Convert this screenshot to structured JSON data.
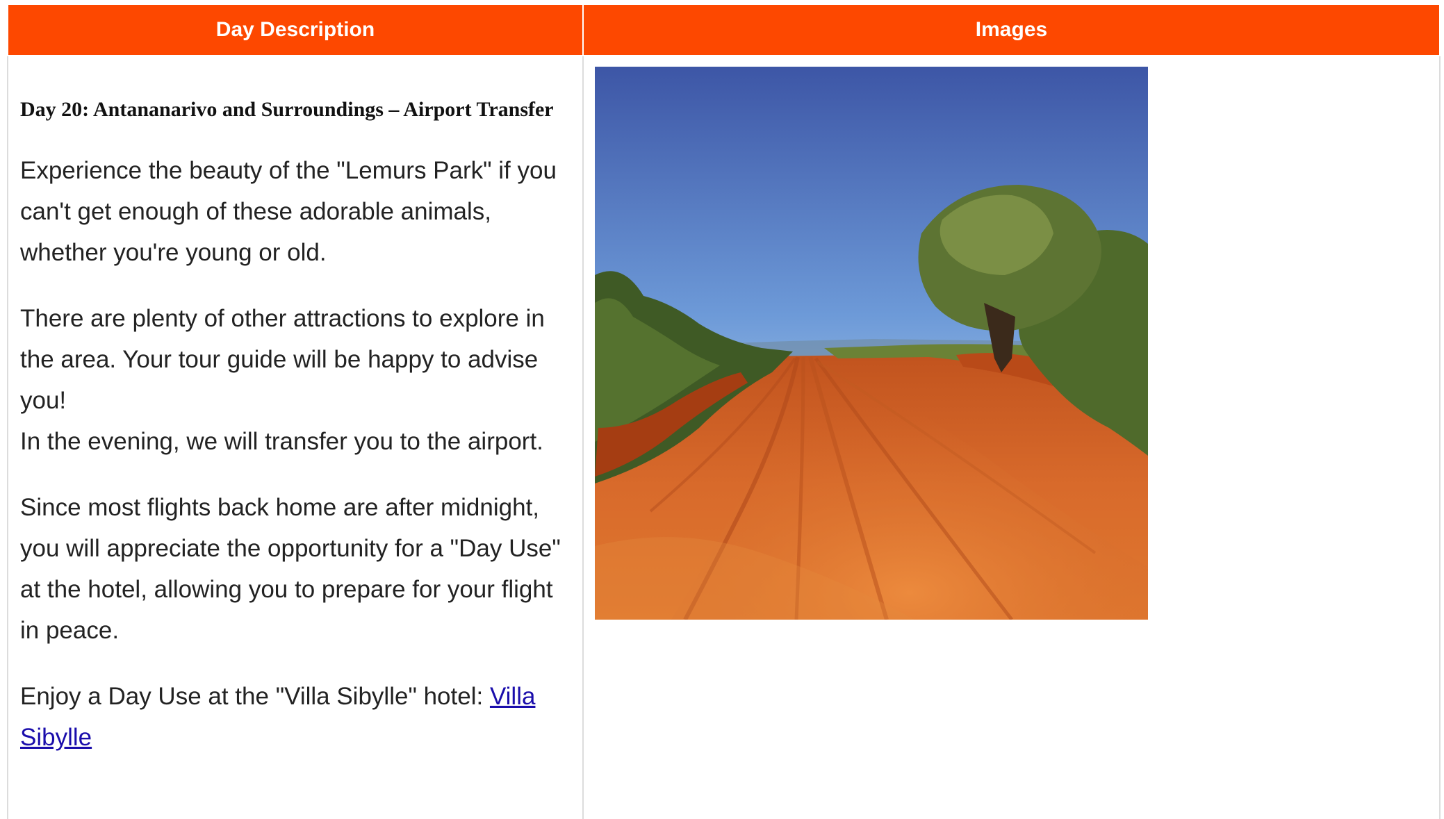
{
  "table": {
    "headers": {
      "description": "Day Description",
      "images": "Images"
    }
  },
  "day": {
    "title": "Day 20: Antananarivo and Surroundings – Airport Transfer",
    "paragraphs": {
      "p1": "Experience the beauty of the \"Lemurs Park\" if you can't get enough of these adorable animals, whether you're young or old.",
      "p2": "There are plenty of other attractions to explore in the area. Your tour guide will be happy to advise you!",
      "p3": "In the evening, we will transfer you to the airport.",
      "p4": "Since most flights back home are after midnight, you will appreciate the opportunity for a \"Day Use\" at the hotel, allowing you to prepare for your flight in peace.",
      "p5_prefix": "Enjoy a Day Use at the \"Villa Sibylle\" hotel: ",
      "p5_link": "Villa Sibylle"
    }
  },
  "colors": {
    "header_bg": "#fd4800",
    "header_text": "#ffffff",
    "link": "#1a0dab"
  }
}
